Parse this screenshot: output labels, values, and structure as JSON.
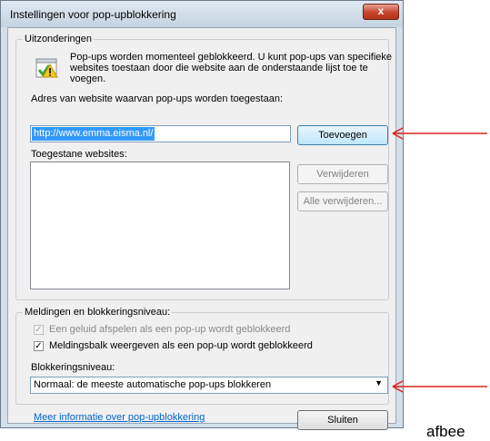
{
  "window": {
    "title": "Instellingen voor pop-upblokkering",
    "close_glyph": "x"
  },
  "exceptions": {
    "group_label": "Uitzonderingen",
    "info_lines": [
      "Pop-ups worden momenteel geblokkeerd. U kunt pop-ups van specifieke",
      "websites toestaan door die website aan de onderstaande lijst toe te",
      "voegen."
    ],
    "address_label": "Adres van website waarvan pop-ups worden toegestaan:",
    "address_value": "http://www.emma.eisma.nl/",
    "add_button": "Toevoegen",
    "allowed_label": "Toegestane websites:",
    "remove_button": "Verwijderen",
    "remove_all_button": "Alle verwijderen..."
  },
  "notifications": {
    "group_label": "Meldingen en blokkeringsniveau:",
    "sound_checkbox": {
      "label": "Een geluid afspelen als een pop-up wordt geblokkeerd",
      "checked": true,
      "disabled": true
    },
    "infobar_checkbox": {
      "label": "Meldingsbalk weergeven als een pop-up wordt geblokkeerd",
      "checked": true,
      "disabled": false
    },
    "level_label": "Blokkeringsniveau:",
    "level_value": "Normaal: de meeste automatische pop-ups blokkeren"
  },
  "footer": {
    "info_link": "Meer informatie over pop-upblokkering",
    "close_button": "Sluiten"
  },
  "annotation_arrows": {
    "color": "#e02020"
  },
  "outside_text": "afbee"
}
